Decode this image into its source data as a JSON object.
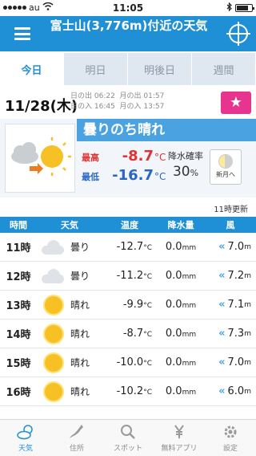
{
  "status_bar": {
    "carrier": "au",
    "time": "11:05"
  },
  "header": {
    "title": "富士山(3,776m)付近の天気"
  },
  "tabs": [
    "今日",
    "明日",
    "明後日",
    "週間"
  ],
  "date": {
    "label": "11/28(木)",
    "sunrise": "日の出 06:22",
    "moonrise": "月の出 01:57",
    "sunset": "日の入 16:45",
    "moonset": "月の入 13:57",
    "star_glyph": "★"
  },
  "summary": {
    "condition": "曇りのち晴れ",
    "high_label": "最高",
    "high_value": "-8.7",
    "low_label": "最低",
    "low_value": "-16.7",
    "unit": "°C",
    "rain_label": "降水確率",
    "rain_value": "30",
    "rain_unit": "%",
    "moon_label": "新月へ"
  },
  "updated_text": "11時更新",
  "table": {
    "headers": [
      "時間",
      "天気",
      "温度",
      "降水量",
      "風"
    ],
    "rows": [
      {
        "time": "11時",
        "icon": "cloud-icon",
        "cond": "曇り",
        "temp": "-12.7",
        "rain": "0.0",
        "wind": "7.0"
      },
      {
        "time": "12時",
        "icon": "cloud-icon",
        "cond": "曇り",
        "temp": "-11.2",
        "rain": "0.0",
        "wind": "7.2"
      },
      {
        "time": "13時",
        "icon": "sun-icon",
        "cond": "晴れ",
        "temp": "-9.9",
        "rain": "0.0",
        "wind": "7.1"
      },
      {
        "time": "14時",
        "icon": "sun-icon",
        "cond": "晴れ",
        "temp": "-8.7",
        "rain": "0.0",
        "wind": "7.3"
      },
      {
        "time": "15時",
        "icon": "sun-icon",
        "cond": "晴れ",
        "temp": "-10.0",
        "rain": "0.0",
        "wind": "7.0"
      },
      {
        "time": "16時",
        "icon": "sun-icon",
        "cond": "晴れ",
        "temp": "-10.2",
        "rain": "0.0",
        "wind": "6.0"
      }
    ],
    "temp_unit": "°C",
    "rain_unit": "mm",
    "wind_unit": "m"
  },
  "tabbar": [
    "天気",
    "住所",
    "スポット",
    "無料アプリ",
    "設定"
  ],
  "colors": {
    "header": "#1f8fd6",
    "accent": "#4aa3e0",
    "high": "#e03434",
    "low": "#2a66c4",
    "star": "#e7348f"
  }
}
